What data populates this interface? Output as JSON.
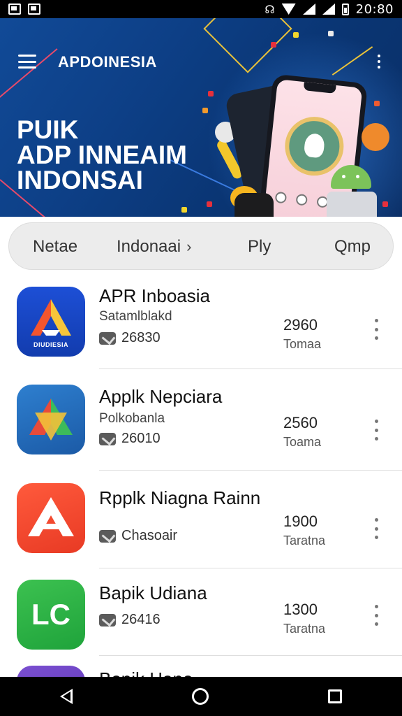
{
  "status_bar": {
    "time": "20:80",
    "icons": [
      "notification-icon",
      "image-notification-icon",
      "vibrate-icon",
      "wifi-icon",
      "signal-icon",
      "signal-icon",
      "battery-icon"
    ]
  },
  "hero": {
    "brand": "APDOINESIA",
    "headline": [
      "PUIK",
      "ADP INNEAIM",
      "INDONSAI"
    ],
    "background_color": "#0d3f86"
  },
  "tabs": [
    {
      "label": "Netae"
    },
    {
      "label": "Indonaai",
      "chevron": "›"
    },
    {
      "label": "Ply"
    },
    {
      "label": "Qmp"
    }
  ],
  "apps": [
    {
      "title": "APR Inboasia",
      "subtitle": "Satamlblakd",
      "downloads": "26830",
      "score": "2960",
      "score_label": "Tomaa",
      "icon_color": "#1d4fd6",
      "icon_caption": "DIUDIESIA"
    },
    {
      "title": "Applk Nepciara",
      "subtitle": "Polkobanla",
      "downloads": "26010",
      "score": "2560",
      "score_label": "Toama",
      "icon_color": "#2e7fcf"
    },
    {
      "title": "Rpplk Niagna Rainn",
      "subtitle": "",
      "downloads": "Chasoair",
      "score": "1900",
      "score_label": "Taratna",
      "icon_color": "#ff5a3c"
    },
    {
      "title": "Bapik Udiana",
      "subtitle": "",
      "downloads": "26416",
      "score": "1300",
      "score_label": "Taratna",
      "icon_color": "#3cc150",
      "icon_text": "LC"
    },
    {
      "title": "Bopik Hano",
      "icon_color": "#7a4fd0"
    }
  ],
  "nav_bar": {
    "icons": [
      "back-icon",
      "home-icon",
      "recents-icon"
    ]
  }
}
